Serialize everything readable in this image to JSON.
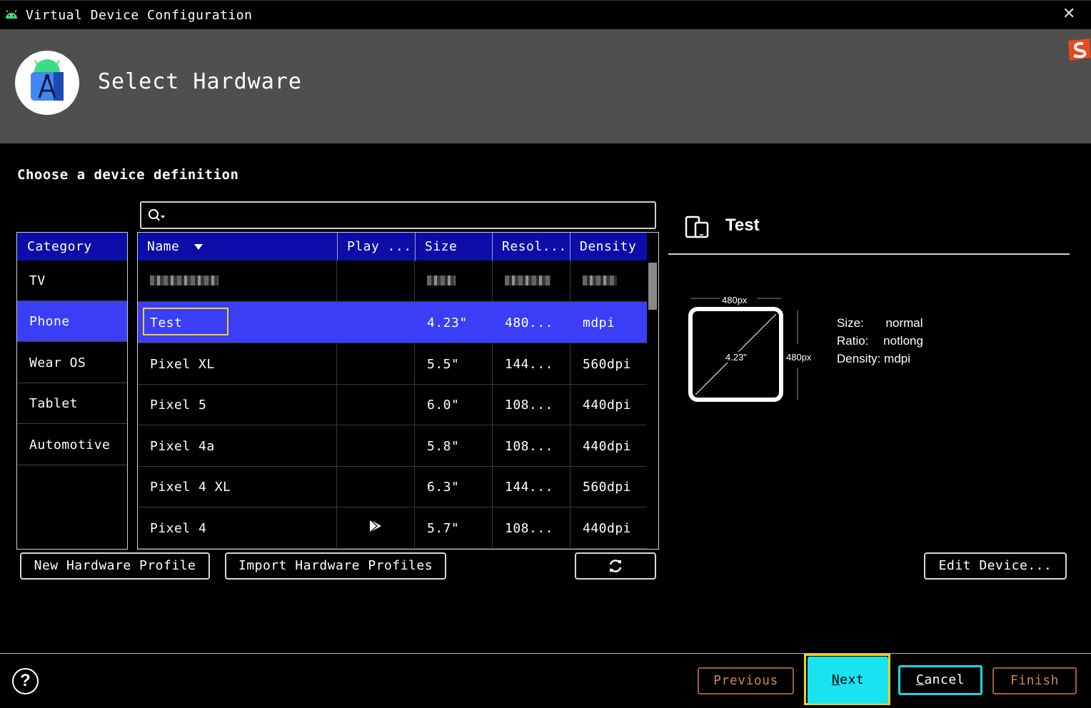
{
  "window": {
    "title": "Virtual Device Configuration",
    "close_glyph": "✕"
  },
  "header": {
    "title": "Select Hardware"
  },
  "section_title": "Choose a device definition",
  "search": {
    "placeholder": "",
    "value": ""
  },
  "category": {
    "header": "Category",
    "items": [
      "TV",
      "Phone",
      "Wear OS",
      "Tablet",
      "Automotive"
    ],
    "selected": "Phone"
  },
  "table": {
    "columns": [
      "Name",
      "Play ...",
      "Size",
      "Resol...",
      "Density"
    ],
    "sort_column": "Name",
    "rows": [
      {
        "name": "",
        "play": "",
        "size": "",
        "resolution": "",
        "density": "",
        "redacted": true
      },
      {
        "name": "Test",
        "play": "",
        "size": "4.23\"",
        "resolution": "480...",
        "density": "mdpi",
        "selected": true
      },
      {
        "name": "Pixel XL",
        "play": "",
        "size": "5.5\"",
        "resolution": "144...",
        "density": "560dpi"
      },
      {
        "name": "Pixel 5",
        "play": "",
        "size": "6.0\"",
        "resolution": "108...",
        "density": "440dpi"
      },
      {
        "name": "Pixel 4a",
        "play": "",
        "size": "5.8\"",
        "resolution": "108...",
        "density": "440dpi"
      },
      {
        "name": "Pixel 4 XL",
        "play": "",
        "size": "6.3\"",
        "resolution": "144...",
        "density": "560dpi"
      },
      {
        "name": "Pixel 4",
        "play": "play-store-icon",
        "size": "5.7\"",
        "resolution": "108...",
        "density": "440dpi"
      }
    ]
  },
  "buttons": {
    "new_profile": "New Hardware Profile",
    "import_profiles": "Import Hardware Profiles",
    "refresh_icon": "refresh-icon",
    "edit_device": "Edit Device..."
  },
  "detail": {
    "name": "Test",
    "width_label": "480px",
    "height_label": "480px",
    "diagonal_label": "4.23\"",
    "size_label": "Size:",
    "size_value": "normal",
    "ratio_label": "Ratio:",
    "ratio_value": "notlong",
    "density_label": "Density:",
    "density_value": "mdpi"
  },
  "footer": {
    "help": "?",
    "previous": "Previous",
    "next_mnemonic": "N",
    "next_rest": "ext",
    "cancel_mnemonic": "C",
    "cancel_rest": "ancel",
    "finish": "Finish"
  },
  "colors": {
    "header_bg": "#4f4f4f",
    "table_header": "#0c0ca8",
    "selection": "#3a3ef7",
    "next_bg": "#19e3f0",
    "highlight": "#f5d11b",
    "disabled_text": "#c58a4a"
  }
}
